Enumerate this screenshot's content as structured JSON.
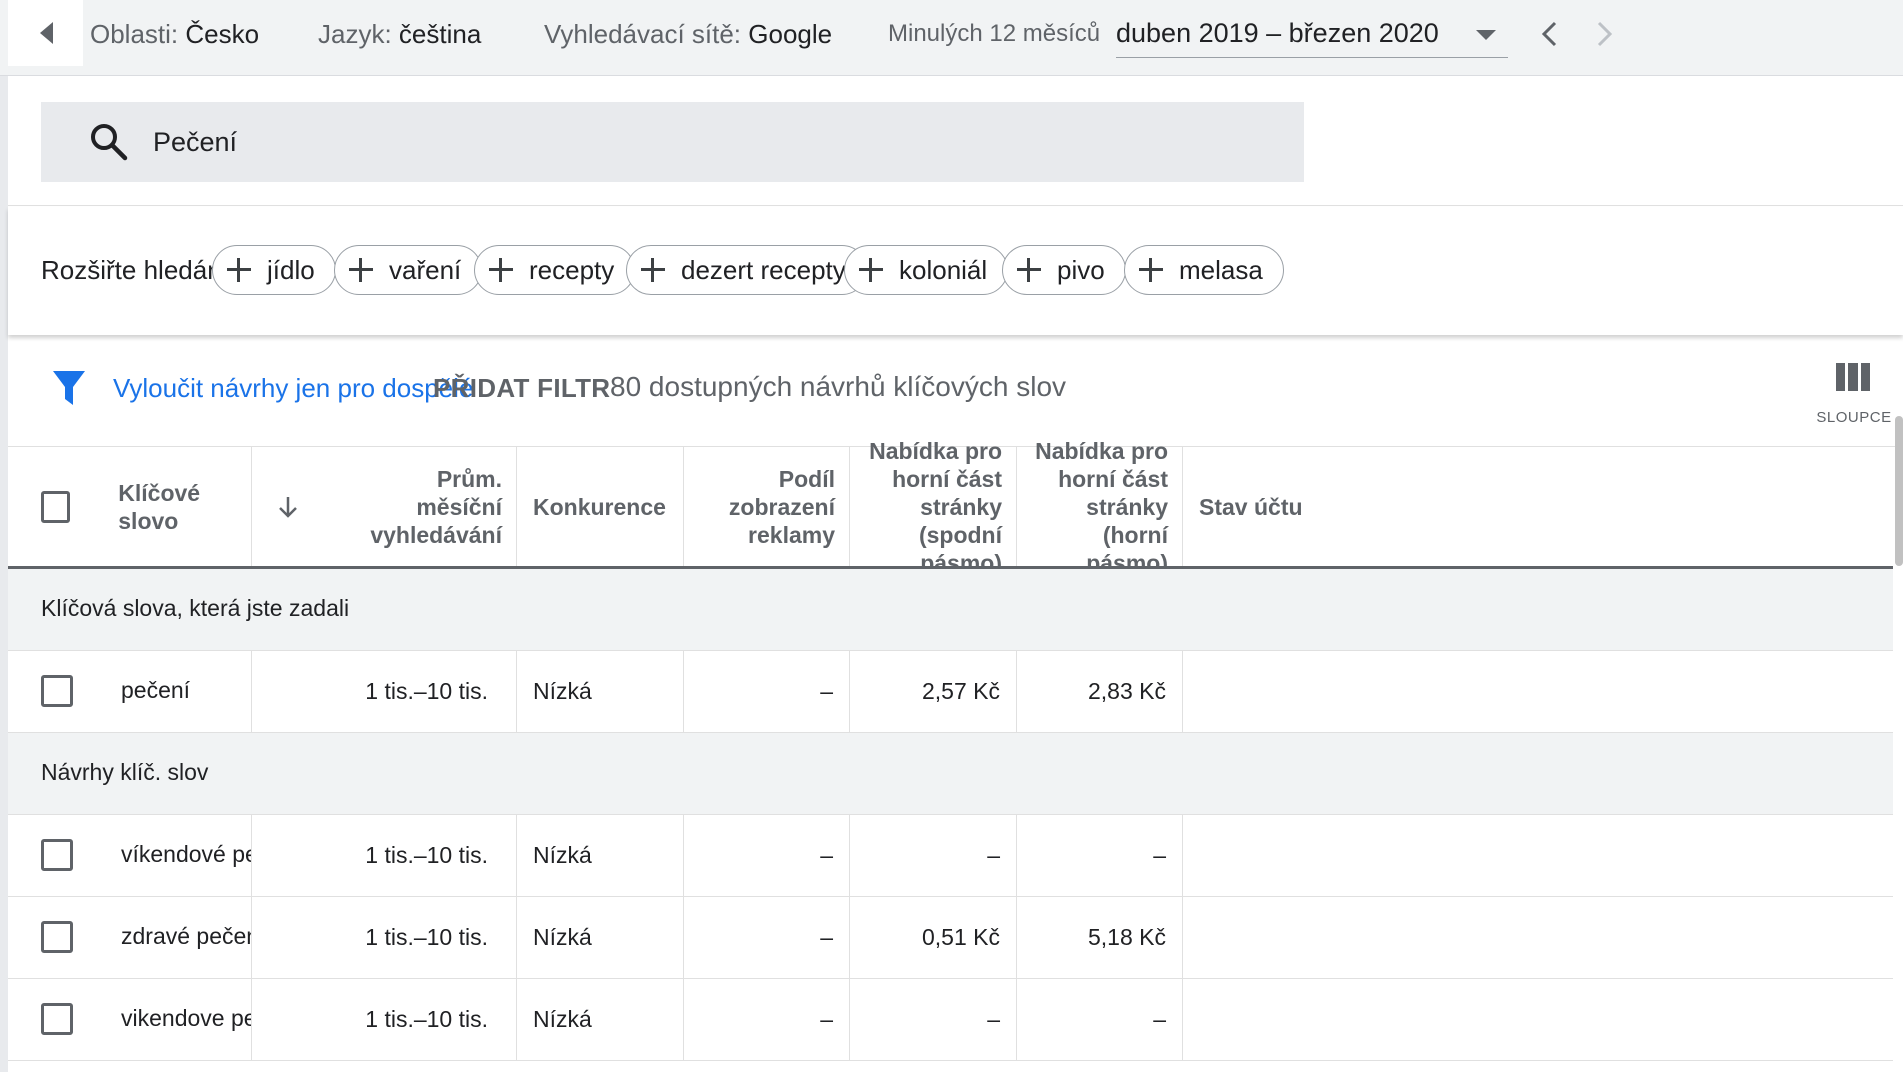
{
  "topbar": {
    "location_label": "Oblasti:",
    "location_value": "Česko",
    "language_label": "Jazyk:",
    "language_value": "čeština",
    "network_label": "Vyhledávací sítě:",
    "network_value": "Google",
    "period_label": "Minulých 12 měsíců",
    "period_value": "duben 2019 – březen 2020"
  },
  "search": {
    "value": "Pečení"
  },
  "expand": {
    "label": "Rozšiřte hledání:",
    "chips": [
      "jídlo",
      "vaření",
      "recepty",
      "dezert recepty",
      "koloniál",
      "pivo",
      "melasa"
    ]
  },
  "filter": {
    "exclude_link": "Vyloučit návrhy jen pro dospělé",
    "add_filter": "PŘIDAT FILTR",
    "count_text": "80 dostupných návrhů klíčových slov",
    "columns_label": "SLOUPCE"
  },
  "table": {
    "headers": {
      "keyword": "Klíčové slovo",
      "avg_searches": "Prům. měsíční vyhledávání",
      "competition": "Konkurence",
      "impression_share": "Podíl zobrazení reklamy",
      "bid_low": "Nabídka pro horní část stránky (spodní pásmo)",
      "bid_high": "Nabídka pro horní část stránky (horní pásmo)",
      "account_status": "Stav účtu"
    },
    "group_entered": "Klíčová slova, která jste zadali",
    "group_ideas": "Návrhy klíč. slov",
    "entered_rows": [
      {
        "keyword": "pečení",
        "searches": "1 tis.–10 tis.",
        "competition": "Nízká",
        "share": "–",
        "bid_low": "2,57 Kč",
        "bid_high": "2,83 Kč",
        "status": ""
      }
    ],
    "idea_rows": [
      {
        "keyword": "víkendové peč…",
        "searches": "1 tis.–10 tis.",
        "competition": "Nízká",
        "share": "–",
        "bid_low": "–",
        "bid_high": "–",
        "status": ""
      },
      {
        "keyword": "zdravé pečení",
        "searches": "1 tis.–10 tis.",
        "competition": "Nízká",
        "share": "–",
        "bid_low": "0,51 Kč",
        "bid_high": "5,18 Kč",
        "status": ""
      },
      {
        "keyword": "vikendove pec…",
        "searches": "1 tis.–10 tis.",
        "competition": "Nízká",
        "share": "–",
        "bid_low": "–",
        "bid_high": "–",
        "status": ""
      }
    ]
  }
}
